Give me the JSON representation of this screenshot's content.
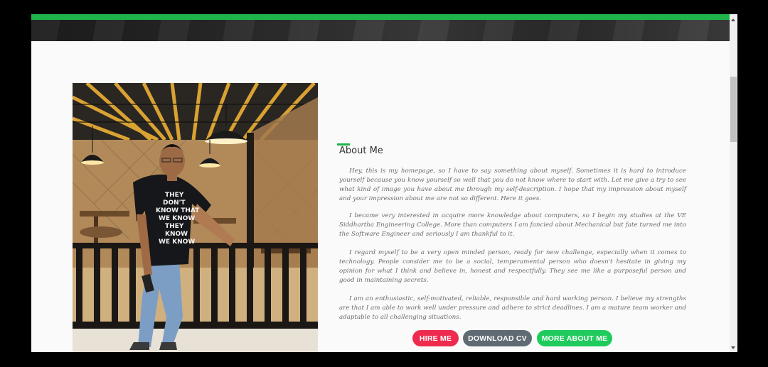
{
  "about": {
    "title": "About Me",
    "paragraphs": [
      "Hey, this is my homepage, so I have to say something about myself. Sometimes it is hard to introduce yourself because you know yourself so well that you do not know where to start with. Let me give a try to see what kind of image you have about me through my self-description. I hope that my impression about myself and your impression about me are not so different. Here it goes.",
      "I became very interested in acquire more knowledge about computers, so I begin my studies at the VE Siddhartha Engineering College. More than computers I am fancied about Mechanical but fate turned me into the Software Engineer and seriously I am thankful to it.",
      "I regard myself to be a very open minded person, ready for new challenge, especially when it comes to technology. People consider me to be a social, temperamental person who doesn't hesitate in giving my opinion for what I think and believe in, honest and respectfully. They see me like a purposeful person and good in maintaining secrets.",
      "I am an enthusiastic, self-motivated, reliable, responsible and hard working person. I believe my strengths are that I am able to work well under pressure and adhere to strict deadlines. I am a mature team worker and adaptable to all challenging situations."
    ]
  },
  "photo": {
    "tshirt_text": [
      "THEY",
      "DON'T",
      "KNOW THAT",
      "WE KNOW",
      "THEY",
      "KNOW",
      "WE KNOW"
    ]
  },
  "buttons": {
    "hire": "HIRE ME",
    "download": "DOWNLOAD CV",
    "more": "MORE ABOUT ME"
  },
  "colors": {
    "accent": "#1fb44b",
    "hire": "#ee2b4f",
    "download": "#5f6a72",
    "more": "#1fcb5c"
  }
}
